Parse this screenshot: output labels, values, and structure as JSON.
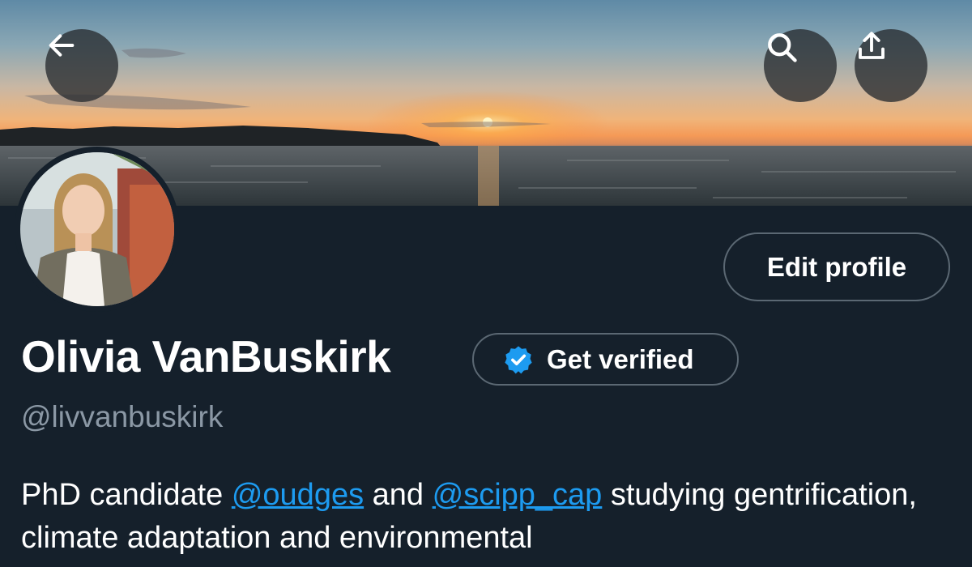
{
  "header": {
    "back_icon": "arrow-left-icon",
    "search_icon": "search-icon",
    "share_icon": "share-upload-icon"
  },
  "profile": {
    "display_name": "Olivia VanBuskirk",
    "handle": "@livvanbuskirk",
    "edit_profile_label": "Edit profile",
    "get_verified_label": "Get verified",
    "verified_badge_color": "#1d9bf0"
  },
  "bio": {
    "text_1": "PhD candidate ",
    "mention_1": "@oudges",
    "text_2": " and ",
    "mention_2": "@scipp_cap",
    "text_3": " studying gentrification, climate adaptation and environmental"
  },
  "colors": {
    "background": "#15202b",
    "link": "#1d9bf0",
    "muted_text": "#8b98a5",
    "button_border": "#5b6873"
  }
}
